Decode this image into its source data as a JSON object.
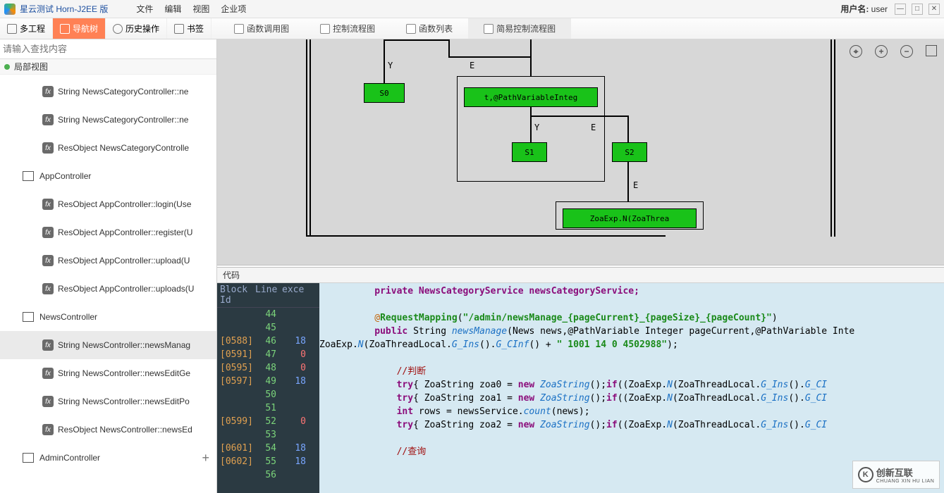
{
  "app": {
    "title": "星云测试 Horn-J2EE 版"
  },
  "menubar": {
    "items": [
      "文件",
      "编辑",
      "视图",
      "企业项"
    ]
  },
  "user": {
    "label": "用户名:",
    "name": "user"
  },
  "toolbar": {
    "multiproject": "多工程",
    "navtree": "导航树",
    "history": "历史操作",
    "bookmark": "书签"
  },
  "tabs": {
    "callgraph": "函数调用图",
    "cflow": "控制流程图",
    "fnlist": "函数列表",
    "simpleflow": "简易控制流程图"
  },
  "sidebar": {
    "search_placeholder": "请输入查找内容",
    "view_label": "局部视图",
    "items": [
      {
        "type": "fn",
        "label": "String NewsCategoryController::ne"
      },
      {
        "type": "fn",
        "label": "String NewsCategoryController::ne"
      },
      {
        "type": "fn",
        "label": "ResObject NewsCategoryControlle"
      },
      {
        "type": "group",
        "label": "AppController"
      },
      {
        "type": "fn",
        "label": "ResObject AppController::login(Use"
      },
      {
        "type": "fn",
        "label": "ResObject AppController::register(U"
      },
      {
        "type": "fn",
        "label": "ResObject AppController::upload(U"
      },
      {
        "type": "fn",
        "label": "ResObject AppController::uploads(U"
      },
      {
        "type": "group",
        "label": "NewsController"
      },
      {
        "type": "fn",
        "label": "String NewsController::newsManag",
        "sel": true
      },
      {
        "type": "fn",
        "label": "String NewsController::newsEditGe"
      },
      {
        "type": "fn",
        "label": "String NewsController::newsEditPo"
      },
      {
        "type": "fn",
        "label": "ResObject NewsController::newsEd"
      },
      {
        "type": "group",
        "label": "AdminController",
        "plus": true
      }
    ]
  },
  "flowchart": {
    "y1": "Y",
    "e1": "E",
    "y2": "Y",
    "e2": "E",
    "e3": "E",
    "s0": "S0",
    "s1": "S1",
    "s2": "S2",
    "box1": "t,@PathVariableInteg",
    "box2": "ZoaExp.N(ZoaThrea"
  },
  "code": {
    "title": "代码",
    "headers": {
      "block": "Block Id",
      "line": "Line",
      "exce": "exce"
    },
    "rows": [
      {
        "b": "",
        "l": "44",
        "e": ""
      },
      {
        "b": "",
        "l": "45",
        "e": ""
      },
      {
        "b": "[0588]",
        "l": "46",
        "e": "18"
      },
      {
        "b": "[0591]",
        "l": "47",
        "e": "0"
      },
      {
        "b": "[0595]",
        "l": "48",
        "e": "0"
      },
      {
        "b": "[0597]",
        "l": "49",
        "e": "18"
      },
      {
        "b": "",
        "l": "50",
        "e": ""
      },
      {
        "b": "",
        "l": "51",
        "e": ""
      },
      {
        "b": "[0599]",
        "l": "52",
        "e": "0"
      },
      {
        "b": "",
        "l": "53",
        "e": ""
      },
      {
        "b": "[0601]",
        "l": "54",
        "e": "18"
      },
      {
        "b": "[0602]",
        "l": "55",
        "e": "18"
      },
      {
        "b": "",
        "l": "56",
        "e": ""
      }
    ],
    "lines": {
      "l44": "          private NewsCategoryService newsCategoryService;",
      "l46a": "          @",
      "l46b": "RequestMapping",
      "l46c": "(",
      "l46d": "\"/admin/newsManage_{pageCurrent}_{pageSize}_{pageCount}\"",
      "l46e": ")",
      "l47a": "          public ",
      "l47b": "String ",
      "l47c": "newsManage",
      "l47d": "(News news,@PathVariable Integer pageCurrent,@PathVariable Inte",
      "l48a": "ZoaExp.",
      "l48b": "N",
      "l48c": "(ZoaThreadLocal.",
      "l48d": "G_Ins",
      "l48e": "().",
      "l48f": "G_CInf",
      "l48g": "() + ",
      "l48h": "\" 1001 14 0 4502988\"",
      "l48i": ");",
      "l50": "              //判断",
      "l51a": "              try",
      "l51b": "{ ZoaString zoa0 = ",
      "l51c": "new ",
      "l51d": "ZoaString",
      "l51e": "();",
      "l51f": "if",
      "l51g": "((ZoaExp.",
      "l51h": "N",
      "l51i": "(ZoaThreadLocal.",
      "l51j": "G_Ins",
      "l51k": "().",
      "l51l": "G_CI",
      "l52a": "              try",
      "l52b": "{ ZoaString zoa1 = ",
      "l52c": "new ",
      "l52d": "ZoaString",
      "l52e": "();",
      "l52f": "if",
      "l52g": "((ZoaExp.",
      "l52h": "N",
      "l52i": "(ZoaThreadLocal.",
      "l52j": "G_Ins",
      "l52k": "().",
      "l52l": "G_CI",
      "l53a": "              int ",
      "l53b": "rows = newsService.",
      "l53c": "count",
      "l53d": "(news);",
      "l54a": "              try",
      "l54b": "{ ZoaString zoa2 = ",
      "l54c": "new ",
      "l54d": "ZoaString",
      "l54e": "();",
      "l54f": "if",
      "l54g": "((ZoaExp.",
      "l54h": "N",
      "l54i": "(ZoaThreadLocal.",
      "l54j": "G_Ins",
      "l54k": "().",
      "l54l": "G_CI",
      "l56": "              //查询"
    }
  },
  "watermark": {
    "name": "创新互联",
    "pinyin": "CHUANG XIN HU LIAN",
    "logo": "K"
  }
}
